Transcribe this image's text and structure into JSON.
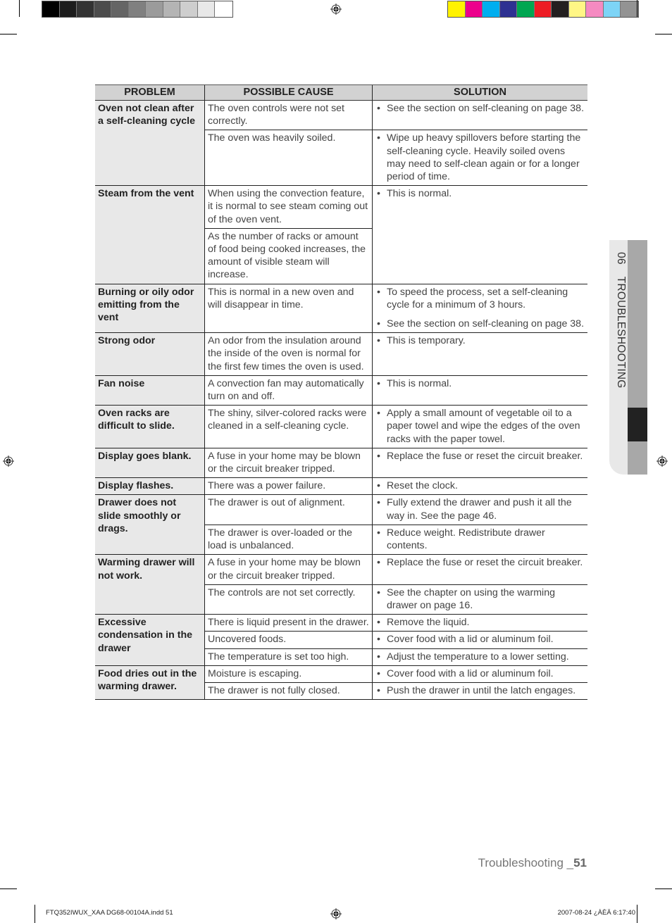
{
  "print_marks": {
    "gray_swatches": [
      "#000000",
      "#1c1c1c",
      "#333333",
      "#4c4c4c",
      "#656565",
      "#808080",
      "#9b9b9b",
      "#b4b4b4",
      "#cecece",
      "#e8e8e8",
      "#ffffff"
    ],
    "color_swatches": [
      "#fff200",
      "#ec008c",
      "#00aeef",
      "#2e3192",
      "#00a651",
      "#ed1c24",
      "#231f20",
      "#fff685",
      "#f58ac1",
      "#7dd4f6",
      "#939393"
    ]
  },
  "table": {
    "headers": [
      "PROBLEM",
      "POSSIBLE CAUSE",
      "SOLUTION"
    ],
    "rows": [
      {
        "problem": "Oven not clean after a self-cleaning cycle",
        "items": [
          {
            "cause": "The oven controls were not set correctly.",
            "solutions": [
              "See the section on self-cleaning on page 38."
            ]
          },
          {
            "cause": "The oven was heavily soiled.",
            "solutions": [
              "Wipe up heavy spillovers before starting the self-cleaning cycle. Heavily soiled ovens may need to self-clean again or for a longer period of time."
            ]
          }
        ]
      },
      {
        "problem": "Steam from the vent",
        "causes": [
          "When using the convection feature, it is normal to see steam coming out of the oven vent.",
          "As the number of racks or amount of food being cooked increases, the amount of visible steam will increase."
        ],
        "solutions": [
          "This is normal."
        ]
      },
      {
        "problem": "Burning or oily odor emitting from the vent",
        "items": [
          {
            "cause": "This is normal in a new oven and will disappear in time.",
            "solutions": [
              "To speed the process, set a self-cleaning cycle for a minimum of 3 hours.",
              "See the section on self-cleaning on page 38."
            ]
          }
        ]
      },
      {
        "problem": "Strong odor",
        "items": [
          {
            "cause": "An odor from the insulation around the inside of the oven is normal for the first few times the oven is used.",
            "solutions": [
              "This is temporary."
            ]
          }
        ]
      },
      {
        "problem": "Fan noise",
        "items": [
          {
            "cause": "A convection fan may automatically turn on and off.",
            "solutions": [
              "This is normal."
            ]
          }
        ]
      },
      {
        "problem": "Oven racks are difficult to slide.",
        "items": [
          {
            "cause": "The shiny, silver-colored racks were cleaned in a self-cleaning cycle.",
            "solutions": [
              "Apply a small amount of vegetable oil to a paper towel and wipe the edges of the oven racks with the paper towel."
            ]
          }
        ]
      },
      {
        "problem": "Display goes blank.",
        "items": [
          {
            "cause": "A fuse in your home may be blown or the circuit breaker tripped.",
            "solutions": [
              "Replace the fuse or reset the circuit breaker."
            ]
          }
        ]
      },
      {
        "problem": "Display flashes.",
        "items": [
          {
            "cause": "There was a power failure.",
            "solutions": [
              "Reset the clock."
            ]
          }
        ]
      },
      {
        "problem": "Drawer does not slide smoothly or drags.",
        "items": [
          {
            "cause": "The drawer is out of alignment.",
            "solutions": [
              "Fully extend the drawer and push it all the way in. See the page 46."
            ]
          },
          {
            "cause": "The drawer is over-loaded or the load is unbalanced.",
            "solutions": [
              "Reduce weight. Redistribute drawer contents."
            ]
          }
        ]
      },
      {
        "problem": "Warming drawer will not work.",
        "items": [
          {
            "cause": "A fuse in your home may be blown or the circuit breaker tripped.",
            "solutions": [
              "Replace the fuse or reset the circuit breaker."
            ]
          },
          {
            "cause": "The controls are not set correctly.",
            "solutions": [
              "See the chapter on using the warming drawer on page 16."
            ]
          }
        ]
      },
      {
        "problem": "Excessive condensation in the drawer",
        "items": [
          {
            "cause": "There is liquid present in the drawer.",
            "solutions": [
              "Remove the liquid."
            ]
          },
          {
            "cause": "Uncovered foods.",
            "solutions": [
              "Cover food with a lid or aluminum foil."
            ]
          },
          {
            "cause": "The temperature is set too high.",
            "solutions": [
              "Adjust the temperature to a lower setting."
            ]
          }
        ]
      },
      {
        "problem": "Food dries out in the warming drawer.",
        "items": [
          {
            "cause": "Moisture is escaping.",
            "solutions": [
              "Cover food with a lid or aluminum foil."
            ]
          },
          {
            "cause": "The drawer is not fully closed.",
            "solutions": [
              "Push the drawer in until the latch engages."
            ]
          }
        ]
      }
    ]
  },
  "side_tab": {
    "number": "06",
    "label": "TROUBLESHOOTING"
  },
  "footer": {
    "section": "Troubleshooting _",
    "page": "51"
  },
  "slug": {
    "file": "FTQ352IWUX_XAA DG68-00104A.indd   51",
    "timestamp": "2007-08-24   ¿ÀÈÄ 6:17:40"
  },
  "bullet": "•"
}
